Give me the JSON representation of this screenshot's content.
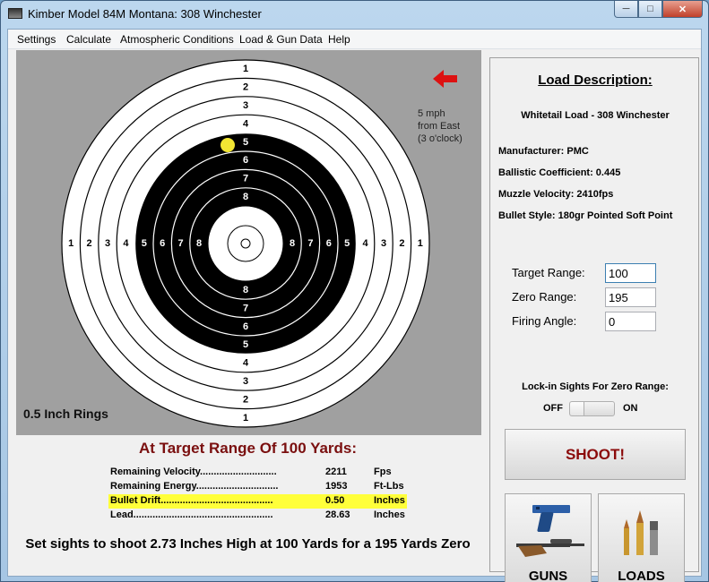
{
  "window": {
    "title": "Kimber Model 84M Montana: 308 Winchester",
    "minimize_icon": "minimize-icon",
    "maximize_icon": "maximize-icon",
    "close_icon": "close-icon"
  },
  "menu": [
    "Settings",
    "Calculate",
    "Atmospheric Conditions",
    "Load & Gun Data",
    "Help"
  ],
  "target": {
    "top_ring_labels": [
      "1",
      "2",
      "3",
      "4",
      "5",
      "6",
      "7",
      "8"
    ],
    "bottom_ring_labels": [
      "8",
      "7",
      "6",
      "5",
      "4",
      "3",
      "2",
      "1"
    ],
    "left_ring_labels": [
      "1",
      "2",
      "3",
      "4",
      "5",
      "6",
      "7",
      "8"
    ],
    "right_ring_labels": [
      "8",
      "7",
      "6",
      "5",
      "4",
      "3",
      "2",
      "1"
    ],
    "rings_label": "0.5 Inch Rings",
    "wind_lines": [
      "5 mph",
      "from East",
      "(3 o'clock)"
    ],
    "wind_arrow_icon": "arrow-left-icon",
    "wind_arrow_color": "#dd1111",
    "impact_color": "#f2e633"
  },
  "results": {
    "title": "At Target Range Of 100 Yards:",
    "rows": [
      {
        "label": "Remaining Velocity............................",
        "value": "2211",
        "unit": "Fps",
        "highlight": false
      },
      {
        "label": "Remaining Energy..............................",
        "value": "1953",
        "unit": "Ft-Lbs",
        "highlight": false
      },
      {
        "label": "Bullet Drift.........................................",
        "value": "0.50",
        "unit": "Inches",
        "highlight": true
      },
      {
        "label": "Lead...................................................",
        "value": "28.63",
        "unit": "Inches",
        "highlight": false
      }
    ],
    "instruction": "Set sights to shoot 2.73 Inches High at 100 Yards for a 195 Yards Zero"
  },
  "load": {
    "title": "Load Description:",
    "name": "Whitetail Load - 308 Winchester",
    "manufacturer": "Manufacturer: PMC",
    "bc": "Ballistic Coefficient: 0.445",
    "velocity": "Muzzle Velocity: 2410fps",
    "bullet": "Bullet Style: 180gr Pointed Soft Point"
  },
  "fields": {
    "target_range_label": "Target Range:",
    "target_range_value": "100",
    "zero_range_label": "Zero Range:",
    "zero_range_value": "195",
    "firing_angle_label": "Firing Angle:",
    "firing_angle_value": "0"
  },
  "lock": {
    "label": "Lock-in Sights For Zero Range:",
    "off": "OFF",
    "on": "ON"
  },
  "buttons": {
    "shoot": "SHOOT!",
    "guns": "GUNS",
    "loads": "LOADS",
    "guns_icon": "pistol-rifle-icon",
    "loads_icon": "ammunition-icon"
  }
}
